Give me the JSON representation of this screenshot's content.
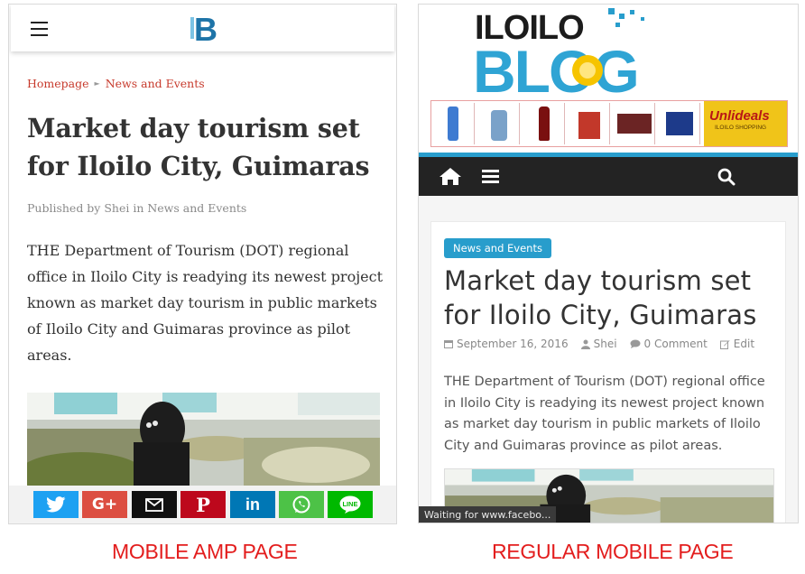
{
  "amp": {
    "logo_letter": "B",
    "breadcrumb": {
      "home": "Homepage",
      "separator": "►",
      "category": "News and Events"
    },
    "title": "Market day tourism set for Iloilo City, Guimaras",
    "meta": "Published by Shei in News and Events",
    "body": "THE Department of Tourism (DOT) regional office in Iloilo City is readying its newest project known as market day tourism in public markets of Iloilo City and Guimaras province as pilot areas.",
    "share_buttons": [
      {
        "name": "twitter",
        "color": "#1da1f2"
      },
      {
        "name": "google-plus",
        "color": "#dc4e41"
      },
      {
        "name": "email",
        "color": "#111111"
      },
      {
        "name": "pinterest",
        "color": "#bd081c"
      },
      {
        "name": "linkedin",
        "color": "#0077b5"
      },
      {
        "name": "whatsapp",
        "color": "#4dc247"
      },
      {
        "name": "line",
        "color": "#00b900"
      }
    ]
  },
  "regular": {
    "logo_top": "ILOILO",
    "logo_bottom": "BLOG",
    "banner_brand": "Unlideals",
    "banner_sub": "ILOILO SHOPPING",
    "category_badge": "News and Events",
    "title": "Market day tourism set for Iloilo City, Guimaras",
    "date": "September 16, 2016",
    "author": "Shei",
    "comments": "0 Comment",
    "edit": "Edit",
    "body": "THE Department of Tourism (DOT) regional office in Iloilo City is readying its newest project known as market day tourism in public markets of Iloilo City and Guimaras province as pilot areas.",
    "status_text": "Waiting for www.facebo..."
  },
  "captions": {
    "left": "MOBILE AMP PAGE",
    "right": "REGULAR MOBILE PAGE"
  },
  "colors": {
    "accent_red": "#e31d1d",
    "blog_blue": "#289dcc",
    "nav_dark": "#232323",
    "breadcrumb_red": "#c73a2c"
  }
}
